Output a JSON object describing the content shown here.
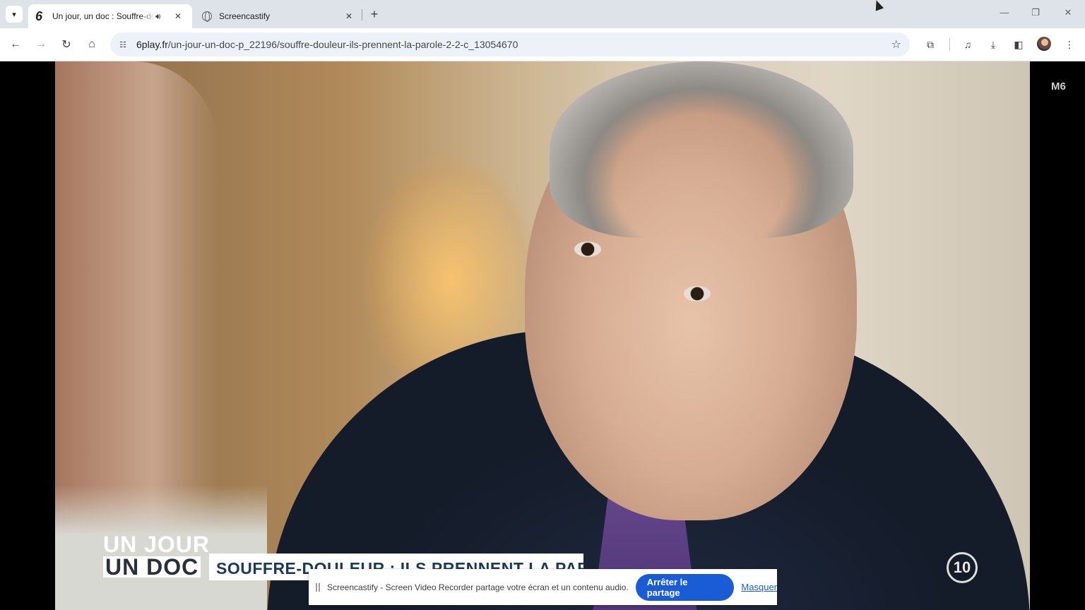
{
  "browser": {
    "tabs": [
      {
        "title": "Un jour, un doc : Souffre-do",
        "favicon": "6",
        "active": true,
        "audio": true
      },
      {
        "title": "Screencastify",
        "favicon": "globe-icon",
        "active": false
      }
    ],
    "url_host": "6play.fr",
    "url_path": "/un-jour-un-doc-p_22196/souffre-douleur-ils-prennent-la-parole-2-2-c_13054670"
  },
  "video": {
    "show_logo_line1": "UN JOUR",
    "show_logo_line2": "UN DOC",
    "title_strip": "SOUFFRE-DOULEUR : ILS PRENNENT LA PAROLE",
    "channel_logo": "10",
    "corner_logo": "M6"
  },
  "share_bar": {
    "message": "Screencastify - Screen Video Recorder partage votre écran et un contenu audio.",
    "stop_label": "Arrêter le partage",
    "hide_label": "Masquer"
  }
}
